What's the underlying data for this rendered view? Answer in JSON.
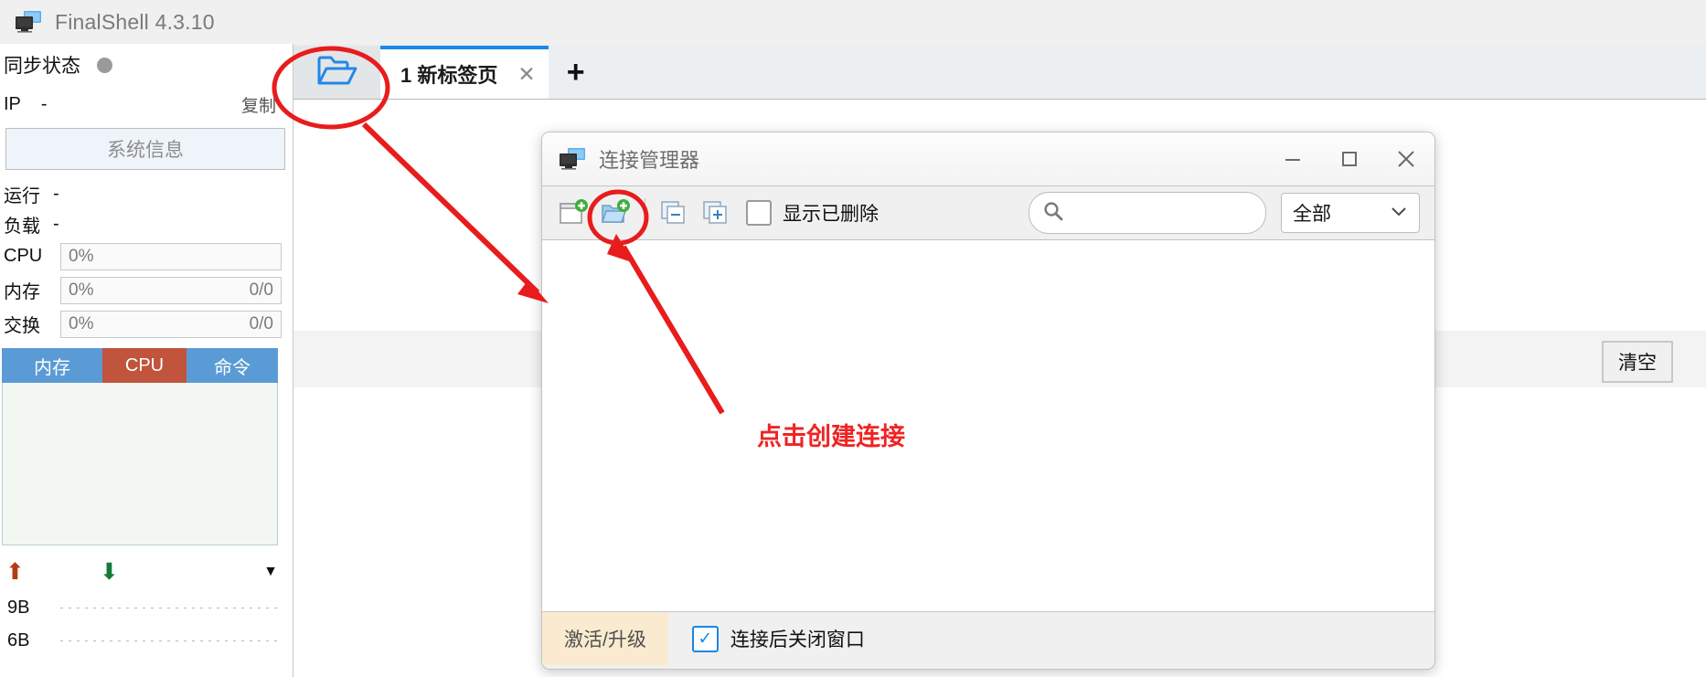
{
  "window": {
    "title": "FinalShell 4.3.10",
    "app_icon": "monitor-icon"
  },
  "sidebar": {
    "sync_label": "同步状态",
    "sync_status_icon": "status-dot",
    "ip_key": "IP",
    "ip_value": "-",
    "copy_label": "复制",
    "sysinfo_label": "系统信息",
    "uptime_key": "运行",
    "uptime_value": "-",
    "load_key": "负载",
    "load_value": "-",
    "meters": [
      {
        "key": "CPU",
        "percent": "0%",
        "detail": ""
      },
      {
        "key": "内存",
        "percent": "0%",
        "detail": "0/0"
      },
      {
        "key": "交换",
        "percent": "0%",
        "detail": "0/0"
      }
    ],
    "proc_tabs": [
      {
        "label": "内存",
        "color": "#5b9bd5"
      },
      {
        "label": "CPU",
        "color": "#c0543c"
      },
      {
        "label": "命令",
        "color": "#5b9bd5"
      }
    ],
    "net_up_icon": "arrow-up-icon",
    "net_down_icon": "arrow-down-icon",
    "net_caret_icon": "caret-down-icon",
    "net_rows": [
      {
        "value": "9B"
      },
      {
        "value": "6B"
      }
    ]
  },
  "tabbar": {
    "folder_button_icon": "open-folder-icon",
    "tab_label": "1 新标签页",
    "tab_close_icon": "close-icon",
    "add_tab_icon": "plus-icon"
  },
  "main": {
    "clear_button": "清空"
  },
  "dialog": {
    "title": "连接管理器",
    "title_icon": "monitor-icon",
    "minimize_icon": "minimize-icon",
    "maximize_icon": "maximize-icon",
    "close_icon": "close-icon",
    "toolbar": {
      "new_connection_icon": "new-file-plus-icon",
      "new_folder_icon": "new-folder-plus-icon",
      "collapse_all_icon": "collapse-all-icon",
      "expand_all_icon": "expand-all-icon",
      "show_deleted_label": "显示已删除",
      "show_deleted_checked": false,
      "search_icon": "search-icon",
      "search_value": "",
      "search_placeholder": "",
      "filter_value": "全部",
      "filter_caret_icon": "chevron-down-icon"
    },
    "footer": {
      "activate_label": "激活/升级",
      "close_after_connect_label": "连接后关闭窗口",
      "close_after_connect_checked": true,
      "checkmark": "✓"
    }
  },
  "annotations": {
    "callout_text": "点击创建连接",
    "color": "#ef2424"
  }
}
